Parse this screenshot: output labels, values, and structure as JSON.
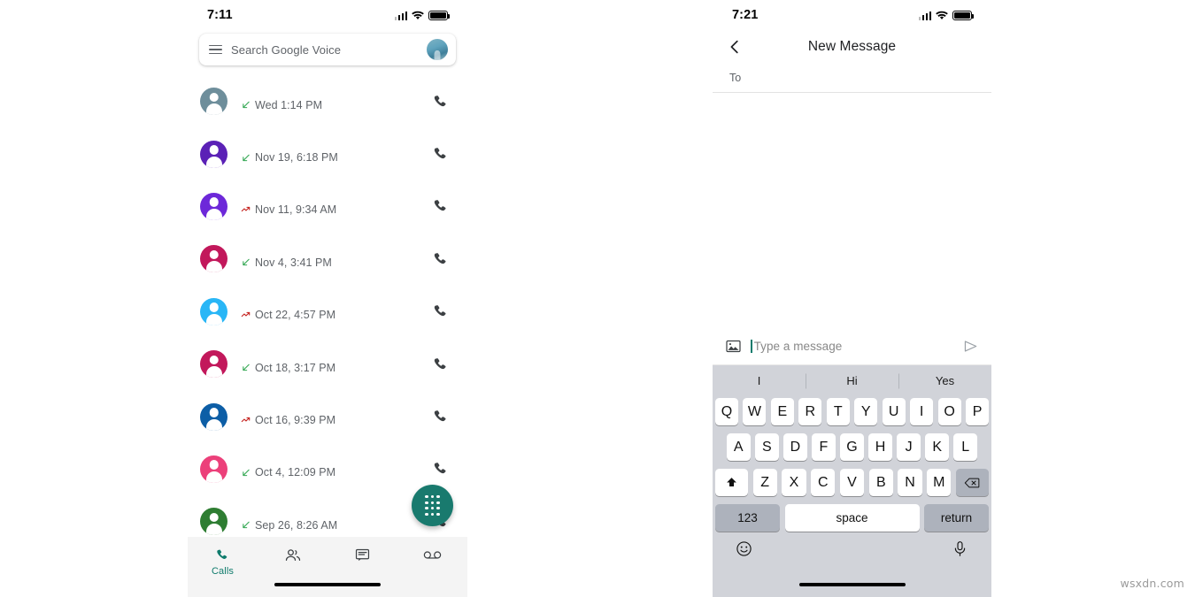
{
  "watermark": "wsxdn.com",
  "left_phone": {
    "status_bar": {
      "time": "7:11",
      "signal_icon": "signal-bars-icon",
      "wifi_icon": "wifi-icon",
      "battery_icon": "battery-icon"
    },
    "search": {
      "menu_icon": "hamburger-menu-icon",
      "placeholder": "Search Google Voice",
      "avatar_icon": "profile-avatar"
    },
    "calls": [
      {
        "name": "",
        "direction": "received",
        "time": "Wed 1:14 PM",
        "avatar_color": "#6E8E9B"
      },
      {
        "name": "",
        "direction": "received",
        "time": "Nov 19, 6:18 PM",
        "avatar_color": "#5B21B6"
      },
      {
        "name": "",
        "direction": "missed",
        "time": "Nov 11, 9:34 AM",
        "avatar_color": "#6D28D9"
      },
      {
        "name": "",
        "direction": "received",
        "time": "Nov 4, 3:41 PM",
        "avatar_color": "#C2185B"
      },
      {
        "name": "",
        "direction": "missed",
        "time": "Oct 22, 4:57 PM",
        "avatar_color": "#29B6F6"
      },
      {
        "name": "",
        "direction": "received",
        "time": "Oct 18, 3:17 PM",
        "avatar_color": "#C2185B"
      },
      {
        "name": "",
        "direction": "missed",
        "time": "Oct 16, 9:39 PM",
        "avatar_color": "#0D5EA6"
      },
      {
        "name": "",
        "direction": "received",
        "time": "Oct 4, 12:09 PM",
        "avatar_color": "#EC407A"
      },
      {
        "name": "",
        "direction": "received",
        "time": "Sep 26, 8:26 AM",
        "avatar_color": "#2E7D32"
      }
    ],
    "fab": {
      "icon": "dialpad-icon",
      "color": "#197A6E"
    },
    "bottom_nav": {
      "active_color": "#0F7B6C",
      "items": [
        {
          "label": "Calls",
          "icon": "phone-icon",
          "active": true
        },
        {
          "label": "",
          "icon": "contacts-icon",
          "active": false
        },
        {
          "label": "",
          "icon": "messages-icon",
          "active": false
        },
        {
          "label": "",
          "icon": "voicemail-icon",
          "active": false
        }
      ]
    }
  },
  "right_phone": {
    "status_bar": {
      "time": "7:21",
      "signal_icon": "signal-bars-icon",
      "wifi_icon": "wifi-icon",
      "battery_icon": "battery-icon"
    },
    "header": {
      "back_icon": "back-chevron-icon",
      "title": "New Message"
    },
    "to_field": {
      "label": "To",
      "value": ""
    },
    "composer": {
      "image_icon": "image-attach-icon",
      "placeholder": "Type a message",
      "value": "",
      "send_icon": "send-icon",
      "caret_color": "#0F7B6C"
    },
    "keyboard": {
      "predictions": [
        "I",
        "Hi",
        "Yes"
      ],
      "row1": [
        "Q",
        "W",
        "E",
        "R",
        "T",
        "Y",
        "U",
        "I",
        "O",
        "P"
      ],
      "row2": [
        "A",
        "S",
        "D",
        "F",
        "G",
        "H",
        "J",
        "K",
        "L"
      ],
      "row3": [
        "Z",
        "X",
        "C",
        "V",
        "B",
        "N",
        "M"
      ],
      "shift_icon": "shift-arrow-icon",
      "backspace_icon": "backspace-icon",
      "numbers_key": "123",
      "space_key": "space",
      "return_key": "return",
      "emoji_icon": "emoji-smiley-icon",
      "mic_icon": "microphone-icon"
    }
  }
}
